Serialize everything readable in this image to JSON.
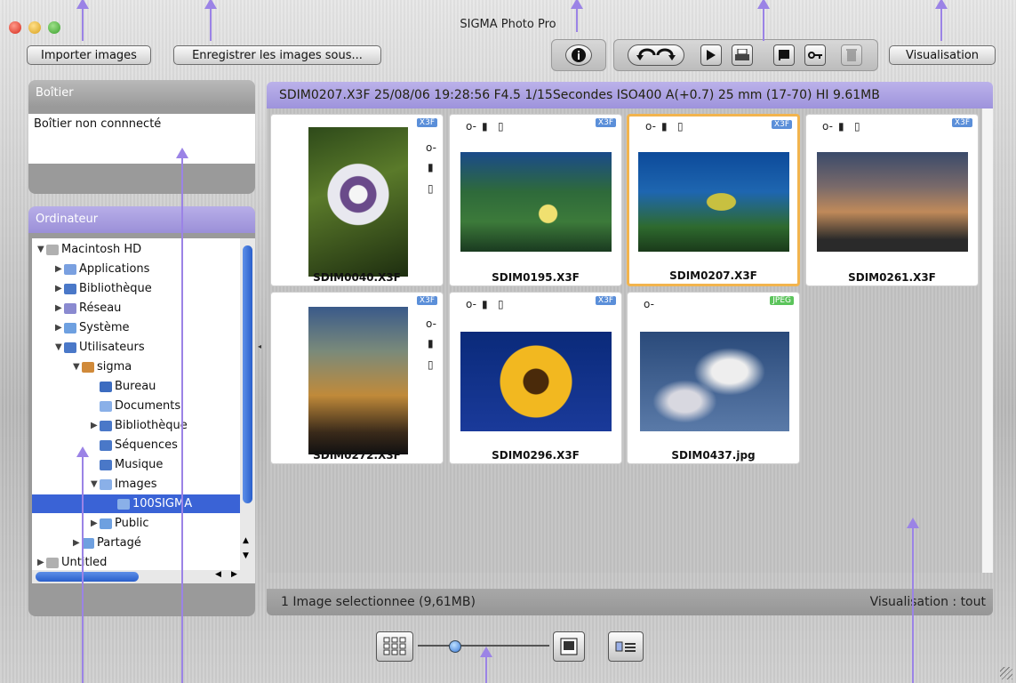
{
  "window": {
    "title": "SIGMA Photo Pro"
  },
  "toolbar": {
    "import_label": "Importer images",
    "save_label": "Enregistrer les images sous...",
    "view_label": "Visualisation"
  },
  "boitier": {
    "header": "Boîtier",
    "status": "Boîtier non connnecté"
  },
  "ordinateur": {
    "header": "Ordinateur",
    "tree": [
      {
        "label": "Macintosh HD",
        "indent": 0,
        "arrow": "▼",
        "color": "#b0b0b0"
      },
      {
        "label": "Applications",
        "indent": 1,
        "arrow": "▶",
        "color": "#7aa0e0"
      },
      {
        "label": "Bibliothèque",
        "indent": 1,
        "arrow": "▶",
        "color": "#4a78c8"
      },
      {
        "label": "Réseau",
        "indent": 1,
        "arrow": "▶",
        "color": "#8a8ad0"
      },
      {
        "label": "Système",
        "indent": 1,
        "arrow": "▶",
        "color": "#6ea0e0"
      },
      {
        "label": "Utilisateurs",
        "indent": 1,
        "arrow": "▼",
        "color": "#4a78c8"
      },
      {
        "label": "sigma",
        "indent": 2,
        "arrow": "▼",
        "color": "#d08a3a"
      },
      {
        "label": "Bureau",
        "indent": 3,
        "arrow": "",
        "color": "#3c6cc0"
      },
      {
        "label": "Documents",
        "indent": 3,
        "arrow": "",
        "color": "#8ab0e8"
      },
      {
        "label": "Bibliothèque",
        "indent": 3,
        "arrow": "▶",
        "color": "#4a78c8"
      },
      {
        "label": "Séquences",
        "indent": 3,
        "arrow": "",
        "color": "#4a78c8"
      },
      {
        "label": "Musique",
        "indent": 3,
        "arrow": "",
        "color": "#4a78c8"
      },
      {
        "label": "Images",
        "indent": 3,
        "arrow": "▼",
        "color": "#8ab0e8"
      },
      {
        "label": "100SIGMA",
        "indent": 4,
        "arrow": "",
        "color": "#8ab0e8",
        "selected": true
      },
      {
        "label": "Public",
        "indent": 3,
        "arrow": "▶",
        "color": "#6ea0e0"
      },
      {
        "label": "Partagé",
        "indent": 2,
        "arrow": "▶",
        "color": "#6ea0e0"
      },
      {
        "label": "Untitled",
        "indent": 0,
        "arrow": "▶",
        "color": "#b0b0b0"
      }
    ]
  },
  "info": {
    "text": "SDIM0207.X3F  25/08/06 19:28:56 F4.5 1/15Secondes ISO400 A(+0.7) 25 mm (17-70) HI  9.61MB"
  },
  "thumbnails": [
    {
      "name": "SDIM0040.X3F",
      "badge": "X3F",
      "selected": false
    },
    {
      "name": "SDIM0195.X3F",
      "badge": "X3F",
      "selected": false
    },
    {
      "name": "SDIM0207.X3F",
      "badge": "X3F",
      "selected": true
    },
    {
      "name": "SDIM0261.X3F",
      "badge": "X3F",
      "selected": false
    },
    {
      "name": "SDIM0272.X3F",
      "badge": "X3F",
      "selected": false
    },
    {
      "name": "SDIM0296.X3F",
      "badge": "X3F",
      "selected": false
    },
    {
      "name": "SDIM0437.jpg",
      "badge": "JPEG",
      "selected": false
    }
  ],
  "status": {
    "selection": "1 Image selectionnee (9,61MB)",
    "view": "Visualisation : tout"
  },
  "colors": {
    "accent_purple": "#9b83e6",
    "selection_orange": "#f2b44d",
    "tree_selection": "#3a63d6"
  }
}
